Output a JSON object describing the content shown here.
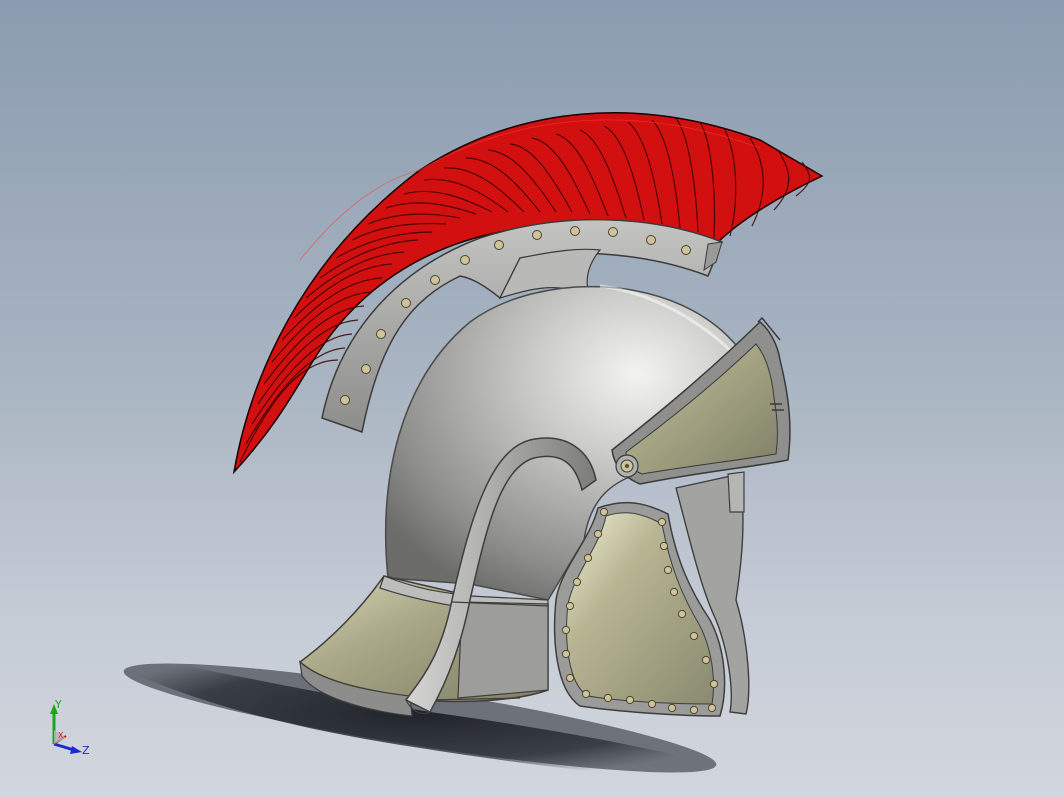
{
  "colors": {
    "background_top": "#8b9cb0",
    "background_bottom": "#d2d6de",
    "plume": "#d01010",
    "steel": "#b8b8b6",
    "brass_panel": "#a8a685",
    "rivet": "#cfc39a"
  },
  "triad": {
    "x_label": "X",
    "y_label": "Y",
    "z_label": "Z"
  }
}
